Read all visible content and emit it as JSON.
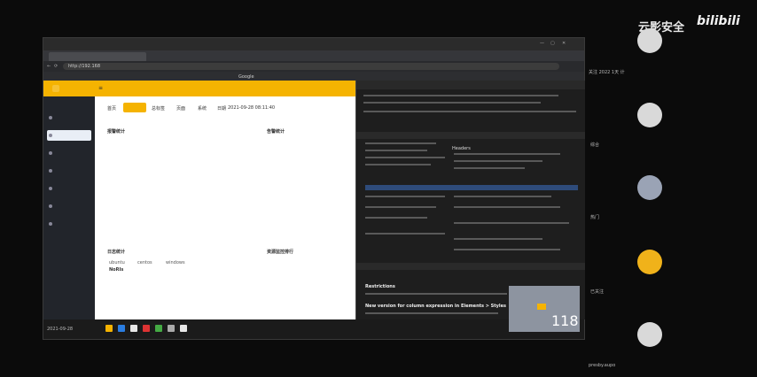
{
  "watermark": {
    "brand": "云影安全",
    "logo": "bilibili"
  },
  "window": {
    "title": "",
    "url": "http://192.168",
    "tab_label": "",
    "bookmark": "Google"
  },
  "app": {
    "nav_title": "",
    "nav_item": "",
    "sidebar_items": [
      "",
      "",
      "",
      "",
      "",
      "",
      ""
    ],
    "tabs": [
      "首页",
      "",
      "总标签",
      "页面",
      "系统",
      "日期"
    ],
    "date_text": "2021-09-28 08:11:40",
    "sections": {
      "top_left": "报警统计",
      "top_right": "告警统计",
      "bottom_left": "日志统计",
      "bottom_right": "资源监控排行"
    },
    "legend_left": [
      "ubuntu",
      "centos",
      "windows"
    ],
    "legend_left_sub": "NoRIs"
  },
  "devtools": {
    "section_header": "Headers",
    "console_title": "Restrictions",
    "console_text": "New version for column expression in Elements > Styles"
  },
  "video": {
    "counter": "118"
  },
  "taskbar": {
    "clock": "2021-09-28"
  },
  "right_panel": {
    "top_text": "关注 2022 1天 计",
    "labels": [
      "综合",
      "热门",
      "已关注"
    ],
    "bottom_text": "presby.aupo"
  },
  "colors": {
    "accent": "#f5b301",
    "page_bg": "#ffffff",
    "dark_bg": "#0b0b0b"
  }
}
